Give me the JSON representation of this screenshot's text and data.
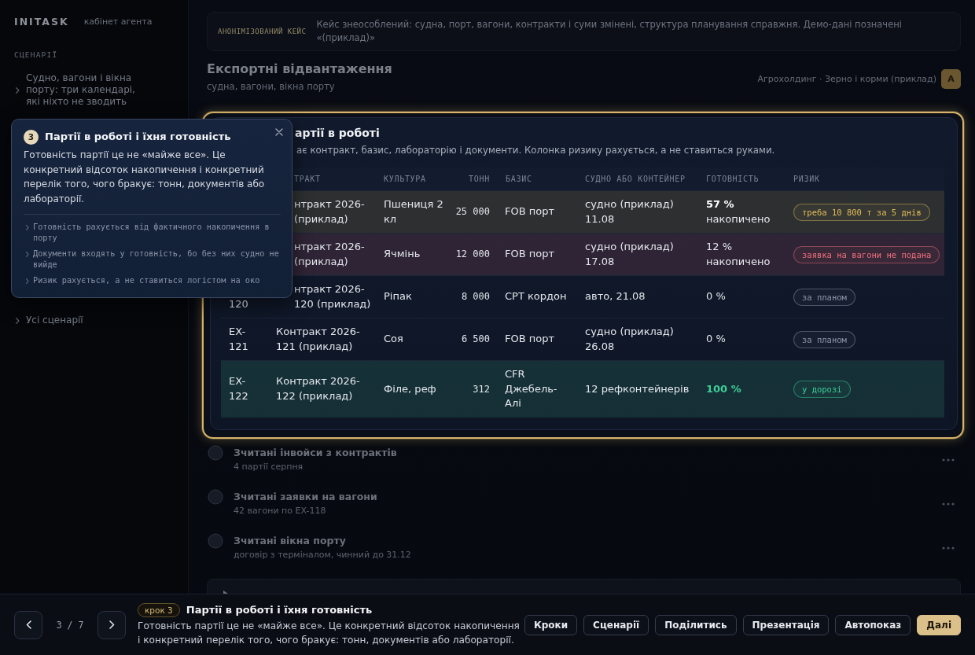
{
  "sidebar": {
    "brand": "INITASK",
    "brand_note": "кабінет агента",
    "section": "СЦЕНАРІЇ",
    "scenario": "Судно, вагони і вікна порту: три календарі, які ніхто не зводить",
    "all_link": "Усі сценарії"
  },
  "notice": {
    "label": "АНОНІМІЗОВАНИЙ КЕЙС",
    "text": "Кейс знеособлений: судна, порт, вагони, контракти і суми змінені, структура планування справжня. Демо-дані позначені «(приклад)»"
  },
  "header": {
    "title": "Експортні відвантаження",
    "subtitle": "судна, вагони, вікна порту",
    "company": "Агрохолдинг · Зерно і корми (приклад)",
    "avatar": "А"
  },
  "batches": {
    "title": "артії в роботі",
    "subtitle": "ає контракт, базис, лабораторію і документи. Колонка ризику рахується, а не ставиться руками.",
    "columns": [
      "ТРАКТ",
      "КУЛЬТУРА",
      "ТОНН",
      "БАЗИС",
      "СУДНО АБО КОНТЕЙНЕР",
      "ГОТОВНІСТЬ",
      "РИЗИК"
    ],
    "rows": [
      {
        "contract": "нтракт 2026-\n(приклад)",
        "crop": "Пшениця 2 кл",
        "tonnes": "25 000",
        "basis": "FOB порт",
        "transport": "судно (приклад) 11.08",
        "readiness": "**57 %** накопичено",
        "complete": false,
        "highlighted": true,
        "risk": {
          "label": "треба 10 800 т за 5 днів",
          "color": "#e3bd5a"
        }
      },
      {
        "contract": "нтракт 2026-\n(приклад)",
        "crop": "Ячмінь",
        "tonnes": "12 000",
        "basis": "FOB порт",
        "transport": "судно (приклад) 17.08",
        "readiness": "12 % накопичено",
        "complete": false,
        "highlighted": true,
        "risk": {
          "label": "заявка на вагони не подана",
          "color": "#ef6f7c"
        }
      },
      {
        "id": "120",
        "contract": "нтракт 2026-\n120 (приклад)",
        "crop": "Ріпак",
        "tonnes": "8 000",
        "basis": "CPT кордон",
        "transport": "авто, 21.08",
        "readiness": "0 %",
        "complete": false,
        "highlighted": false,
        "risk": {
          "label": "за планом",
          "color": "#8e97aa"
        }
      },
      {
        "id": "EX-\n121",
        "contract": "Контракт 2026-\n121 (приклад)",
        "crop": "Соя",
        "tonnes": "6 500",
        "basis": "FOB порт",
        "transport": "судно (приклад) 26.08",
        "readiness": "0 %",
        "complete": false,
        "highlighted": false,
        "risk": {
          "label": "за планом",
          "color": "#8e97aa"
        }
      },
      {
        "id": "EX-\n122",
        "contract": "Контракт 2026-\n122 (приклад)",
        "crop": "Філе, реф",
        "tonnes": "312",
        "basis": "CFR Джебель-Алі",
        "transport": "12 рефконтейнерів",
        "readiness": "100 %",
        "complete": true,
        "highlighted": true,
        "risk": {
          "label": "у дорозі",
          "color": "#3fcf98"
        }
      }
    ]
  },
  "events": [
    {
      "title": "Зчитані інвойси з контрактів",
      "note": "4 партії серпня"
    },
    {
      "title": "Зчитані заявки на вагони",
      "note": "42 вагони по EX-118"
    },
    {
      "title": "Зчитані вікна порту",
      "note": "договір з терміналом, чинний до 31.12"
    }
  ],
  "tour": {
    "step": "3",
    "title": "Партії в роботі і їхня готовність",
    "text": "Готовність партії це не «майже все». Це конкретний відсоток накопичення і конкретний перелік того, чого бракує: тонн, документів або лабораторії.",
    "points": [
      "Готовність рахується від фактичного накопичення в порту",
      "Документи входять у готовність, бо без них судно не вийде",
      "Ризик рахується, а не ставиться логістом на око"
    ]
  },
  "footer": {
    "counter": "3 / 7",
    "step_badge": "крок 3",
    "title": "Партії в роботі і їхня готовність",
    "text": "Готовність партії це не «майже все». Це конкретний відсоток накопичення і конкретний перелік того, чого бракує: тонн, документів або лабораторії.",
    "buttons": [
      {
        "label": "Кроки",
        "kind": "secondary"
      },
      {
        "label": "Сценарії",
        "kind": "secondary"
      },
      {
        "label": "Поділитись",
        "kind": "secondary"
      },
      {
        "label": "Презентація",
        "kind": "secondary"
      },
      {
        "label": "Автопоказ",
        "kind": "secondary"
      },
      {
        "label": "Далі",
        "kind": "primary"
      }
    ]
  }
}
